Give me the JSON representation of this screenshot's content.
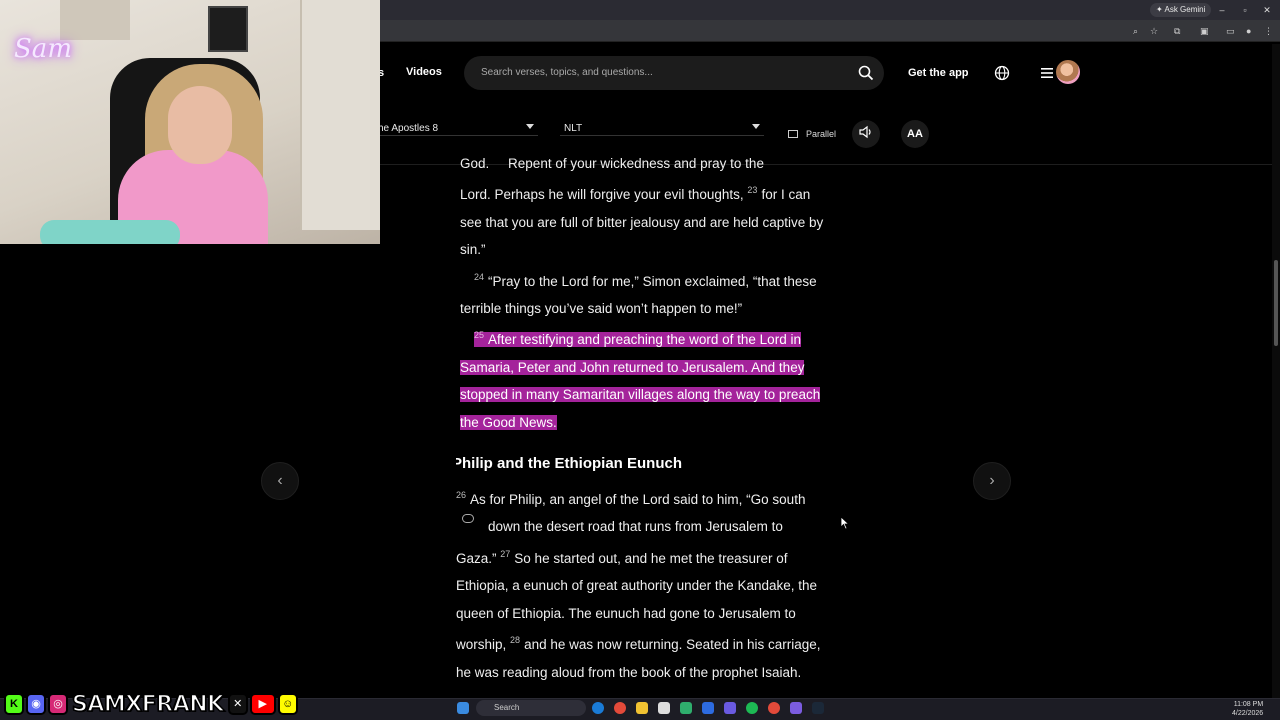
{
  "browser": {
    "ask_gemini_label": "Ask Gemini",
    "window_controls": [
      "–",
      "▫",
      "✕"
    ]
  },
  "site_header": {
    "nav_partial_label": "s",
    "nav_videos_label": "Videos",
    "search_placeholder": "Search verses, topics, and questions...",
    "get_app_label": "Get the app"
  },
  "selectors": {
    "book_chapter": "he Apostles 8",
    "version": "NLT",
    "parallel_label": "Parallel",
    "text_size_label": "AA"
  },
  "reader": {
    "line_partial_top": "God. ",
    "line_partial_top_rest": "Repent of your wickedness and pray to the",
    "v22_rest": "Lord. Perhaps he will forgive your evil thoughts,",
    "v23_num": "23",
    "v23_text": "for I can see that you are full of bitter jealousy and are held captive by sin.”",
    "v24_num": "24",
    "v24_text": "“Pray to the Lord for me,” Simon exclaimed, “that these terrible things you’ve said won’t happen to me!”",
    "v25_num": "25",
    "v25_text": "After testifying and preaching the word of the Lord in Samaria, Peter and John returned to Jerusalem. And they stopped in many Samaritan villages along the way to preach the Good News.",
    "section_heading": "Philip and the Ethiopian Eunuch",
    "v26_num": "26",
    "v26_text_a": "As for Philip, an angel of the Lord said to him, “Go south",
    "v26_text_b": "down the desert road that runs from Jerusalem to Gaza.”",
    "v27_num": "27",
    "v27_text": "So he started out, and he met the treasurer of Ethiopia, a eunuch of great authority under the Kandake, the queen of Ethiopia. The eunuch had gone to Jerusalem to worship,",
    "v28_num": "28",
    "v28_text": "and he was now returning. Seated in his carriage, he was reading aloud from the book of the prophet Isaiah."
  },
  "overlay": {
    "webcam_logo": "Sam",
    "social_handle": "SAMXFRANK",
    "social_icons": [
      "kick-icon",
      "discord-icon",
      "instagram-icon",
      "x-icon",
      "youtube-icon",
      "snapchat-icon"
    ]
  },
  "taskbar": {
    "search_label": "Search",
    "time": "11:08 PM",
    "date": "4/22/2026"
  },
  "colors": {
    "highlight": "#a4239b",
    "background": "#000000",
    "search_bg": "#1c1c1c"
  }
}
